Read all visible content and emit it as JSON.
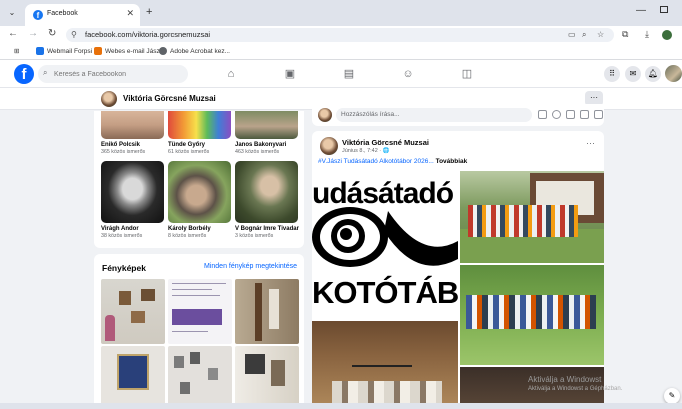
{
  "browser": {
    "tab_title": "Facebook",
    "tab_favicon": "f",
    "url": "facebook.com/viktoria.gorcsnemuzsai",
    "bookmarks": [
      {
        "label": "Webmail Forpsi",
        "color": "#1a73e8"
      },
      {
        "label": "Webes e-mail Jász",
        "color": "#e8710a"
      },
      {
        "label": "Adobe Acrobat kez...",
        "color": "#5f6368"
      }
    ]
  },
  "fb": {
    "search_placeholder": "Keresés a Facebookon",
    "logo": "f"
  },
  "profile": {
    "name": "Viktória Görcsné Muzsai"
  },
  "friends": [
    {
      "name": "Enikő Polcsik",
      "mutual": "365 közös ismerős"
    },
    {
      "name": "Tünde Győry",
      "mutual": "61 közös ismerős"
    },
    {
      "name": "Janos Bakonyvari",
      "mutual": "463 közös ismerős"
    },
    {
      "name": "Virágh Andor",
      "mutual": "38 közös ismerős"
    },
    {
      "name": "Károly Borbély",
      "mutual": "8 közös ismerős"
    },
    {
      "name": "V Bognár Imre Tivadar",
      "mutual": "3 közös ismerős"
    }
  ],
  "photos": {
    "title": "Fényképek",
    "see_all": "Minden fénykép megtekintése"
  },
  "composer": {
    "placeholder": "Hozzászólás írása..."
  },
  "post": {
    "author": "Viktória Görcsné Muzsai",
    "time": "Június 8., 7:42 · 🌐",
    "hashtag": "#V.Jászi Tudásátadó Alkotótábor 2026...",
    "more": "Továbbiak",
    "poster_line1": "udásátadó JÁS",
    "poster_line2": "KOTÓTÁBO"
  },
  "os": {
    "activate_title": "Aktiválja a Windowst",
    "activate_sub": "Aktiválja a Windowst a Gépházban."
  },
  "colors": {
    "fb_blue": "#0866ff",
    "bg": "#f0f2f5"
  }
}
